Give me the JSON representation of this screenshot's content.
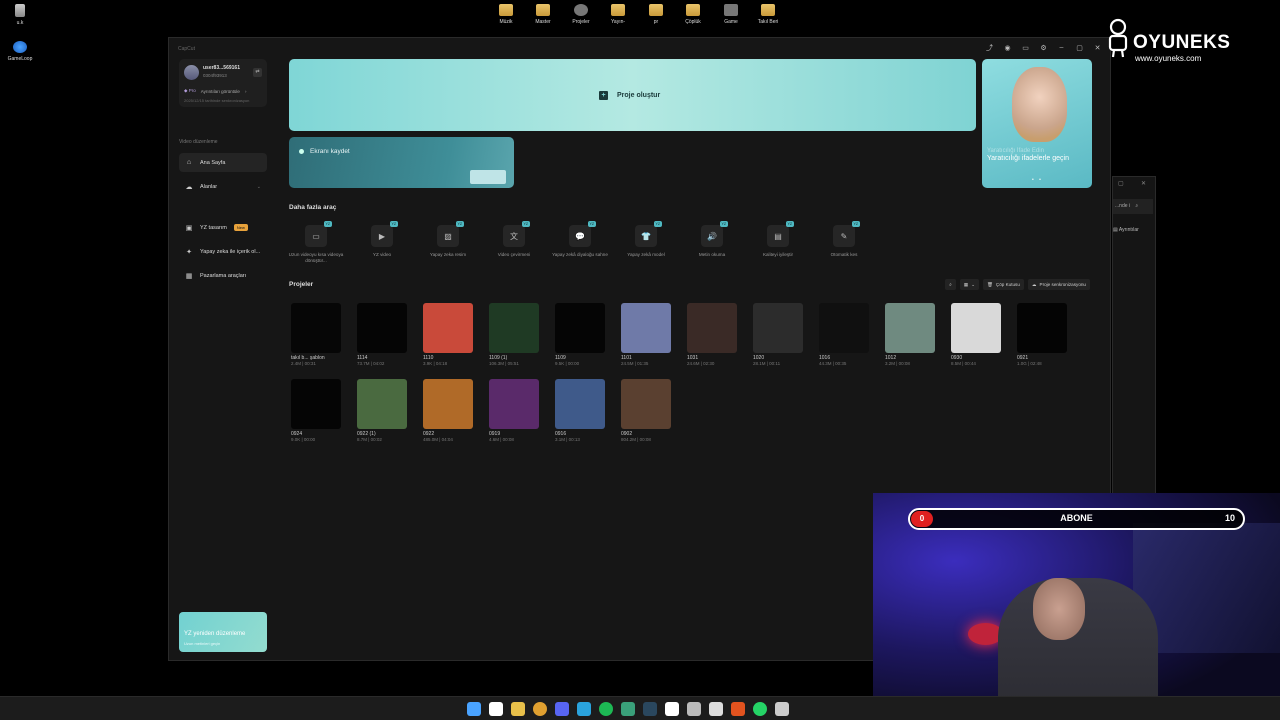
{
  "desktop": {
    "left_icons": [
      {
        "label": "u.k",
        "icon": "recycle-bin-icon"
      },
      {
        "label": "GameLoop",
        "icon": "gameloop-icon"
      }
    ],
    "top_icons": [
      "Müzik",
      "Master",
      "Projeler",
      "Yayın-",
      "pr",
      "Çöplük",
      "Game",
      "Takıl Beri"
    ]
  },
  "window": {
    "app_title": "CapCut",
    "controls": [
      "share-icon",
      "help-icon",
      "layout-icon",
      "settings-icon",
      "minimize-icon",
      "maximize-icon",
      "close-icon"
    ]
  },
  "sidebar": {
    "user": {
      "name": "user83...569161",
      "id": "0304f93913"
    },
    "pro_label": "Pro",
    "pro_link": "Ayrıntıları görüntüle",
    "sync_date": "2025/12/15 tarihinde senkronizasyon",
    "section_label": "Video düzenleme",
    "items": [
      {
        "label": "Ana Sayfa",
        "icon": "home-icon",
        "active": true
      },
      {
        "label": "Alanlar",
        "icon": "cloud-icon"
      },
      {
        "label": "YZ tasarım",
        "icon": "design-icon",
        "badge": "New"
      },
      {
        "label": "Yapay zeka ile içerik ol...",
        "icon": "sparkle-icon"
      },
      {
        "label": "Pazarlama araçları",
        "icon": "marketing-icon"
      }
    ],
    "promo": {
      "title": "YZ yeniden düzenleme",
      "subtitle": "Uzun metinleri geçin"
    }
  },
  "hero": {
    "create_label": "Proje oluştur"
  },
  "side_card": {
    "title": "Yaratıcılığı İfade Edin",
    "subtitle": "Yaratıcılığı ifadelerle geçin"
  },
  "record": {
    "label": "Ekranı kaydet"
  },
  "tools": {
    "title": "Daha fazla araç",
    "badge": "YZ",
    "items": [
      {
        "label": "Uzun videoyu kısa videoya dönüştür...",
        "icon": "film-icon"
      },
      {
        "label": "YZ video",
        "icon": "ai-video-icon"
      },
      {
        "label": "Yapay zeka resim",
        "icon": "image-icon"
      },
      {
        "label": "Video çevirmeni",
        "icon": "translate-icon"
      },
      {
        "label": "Yapay zekâ diyaloğu sahne",
        "icon": "dialogue-icon"
      },
      {
        "label": "Yapay zekâ model",
        "icon": "shirt-icon"
      },
      {
        "label": "Metin okuma",
        "icon": "speech-icon"
      },
      {
        "label": "Kaliteyi iyileştir",
        "icon": "enhance-icon"
      },
      {
        "label": "Otomatik kes",
        "icon": "eraser-icon"
      }
    ]
  },
  "projects": {
    "title": "Projeler",
    "trash_label": "Çöp Kutusu",
    "sync_label": "Proje senkronizasyonu",
    "items": [
      {
        "name": "takıl b... şablon",
        "meta": "2.4M | 00:31",
        "thumb": "#060606"
      },
      {
        "name": "1114",
        "meta": "73.7M | 04:02",
        "thumb": "#050505"
      },
      {
        "name": "1110",
        "meta": "3.9K | 04:18",
        "thumb": "#c94a3a"
      },
      {
        "name": "1109 (1)",
        "meta": "106.3M | 05:51",
        "thumb": "#1f3a24"
      },
      {
        "name": "1109",
        "meta": "9.5K | 00:00",
        "thumb": "#050505"
      },
      {
        "name": "1101",
        "meta": "24.5M | 01:35",
        "thumb": "#6f7aa8"
      },
      {
        "name": "1031",
        "meta": "24.6M | 02:30",
        "thumb": "#3a2a26"
      },
      {
        "name": "1020",
        "meta": "28.1M | 00:11",
        "thumb": "#2c2c2c"
      },
      {
        "name": "1016",
        "meta": "44.3M | 00:35",
        "thumb": "#101010"
      },
      {
        "name": "1012",
        "meta": "3.2M | 00:08",
        "thumb": "#6f8a80"
      },
      {
        "name": "0930",
        "meta": "8.5M | 00:44",
        "thumb": "#d9d9d9"
      },
      {
        "name": "0921",
        "meta": "1.0G | 02:48",
        "thumb": "#040404"
      },
      {
        "name": "0924",
        "meta": "9.0K | 00:00",
        "thumb": "#050505"
      },
      {
        "name": "0922 (1)",
        "meta": "8.7M | 00:02",
        "thumb": "#4a6a40"
      },
      {
        "name": "0922",
        "meta": "485.0M | 04:04",
        "thumb": "#b06a28"
      },
      {
        "name": "0919",
        "meta": "4.6M | 00:08",
        "thumb": "#5a2a6a"
      },
      {
        "name": "0916",
        "meta": "3.1M | 00:13",
        "thumb": "#3f5a8a"
      },
      {
        "name": "0902",
        "meta": "804.2M | 00:08",
        "thumb": "#5a4030"
      }
    ]
  },
  "background_window": {
    "search_placeholder": "...nde i",
    "details_label": "Ayrıntılar"
  },
  "brand": {
    "name": "OYUNEKS",
    "url": "www.oyuneks.com"
  },
  "stream_overlay": {
    "current": "0",
    "label": "ABONE",
    "goal": "10"
  },
  "taskbar": {
    "icons": [
      "windows-icon",
      "search-icon",
      "files-icon",
      "chrome-icon",
      "discord-icon",
      "telegram-icon",
      "spotify-icon",
      "app-icon",
      "steam-icon",
      "capcut-icon",
      "obs-icon",
      "mail-icon",
      "fox-icon",
      "whatsapp-icon",
      "app2-icon"
    ],
    "colors": [
      "#4aa3ff",
      "#ffffff",
      "#e8c04a",
      "#e0a030",
      "#5865f2",
      "#2aa3dd",
      "#1db954",
      "#3aa07a",
      "#2a475e",
      "#ffffff",
      "#bbbbbb",
      "#dddddd",
      "#e2531f",
      "#25d366",
      "#cccccc"
    ]
  }
}
